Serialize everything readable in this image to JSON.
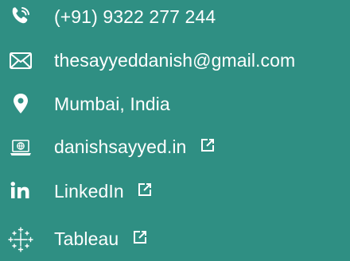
{
  "contact": {
    "phone": "(+91) 9322 277 244",
    "email": "thesayyeddanish@gmail.com",
    "location": "Mumbai, India",
    "website": "danishsayyed.in",
    "linkedin": "LinkedIn",
    "tableau": "Tableau"
  },
  "icons": {
    "phone": "phone-icon",
    "email": "mail-icon",
    "location": "location-pin-icon",
    "website": "laptop-globe-icon",
    "linkedin": "linkedin-icon",
    "tableau": "tableau-icon",
    "external": "external-link-icon"
  },
  "colors": {
    "background": "#2f8f83",
    "text": "#ffffff"
  }
}
